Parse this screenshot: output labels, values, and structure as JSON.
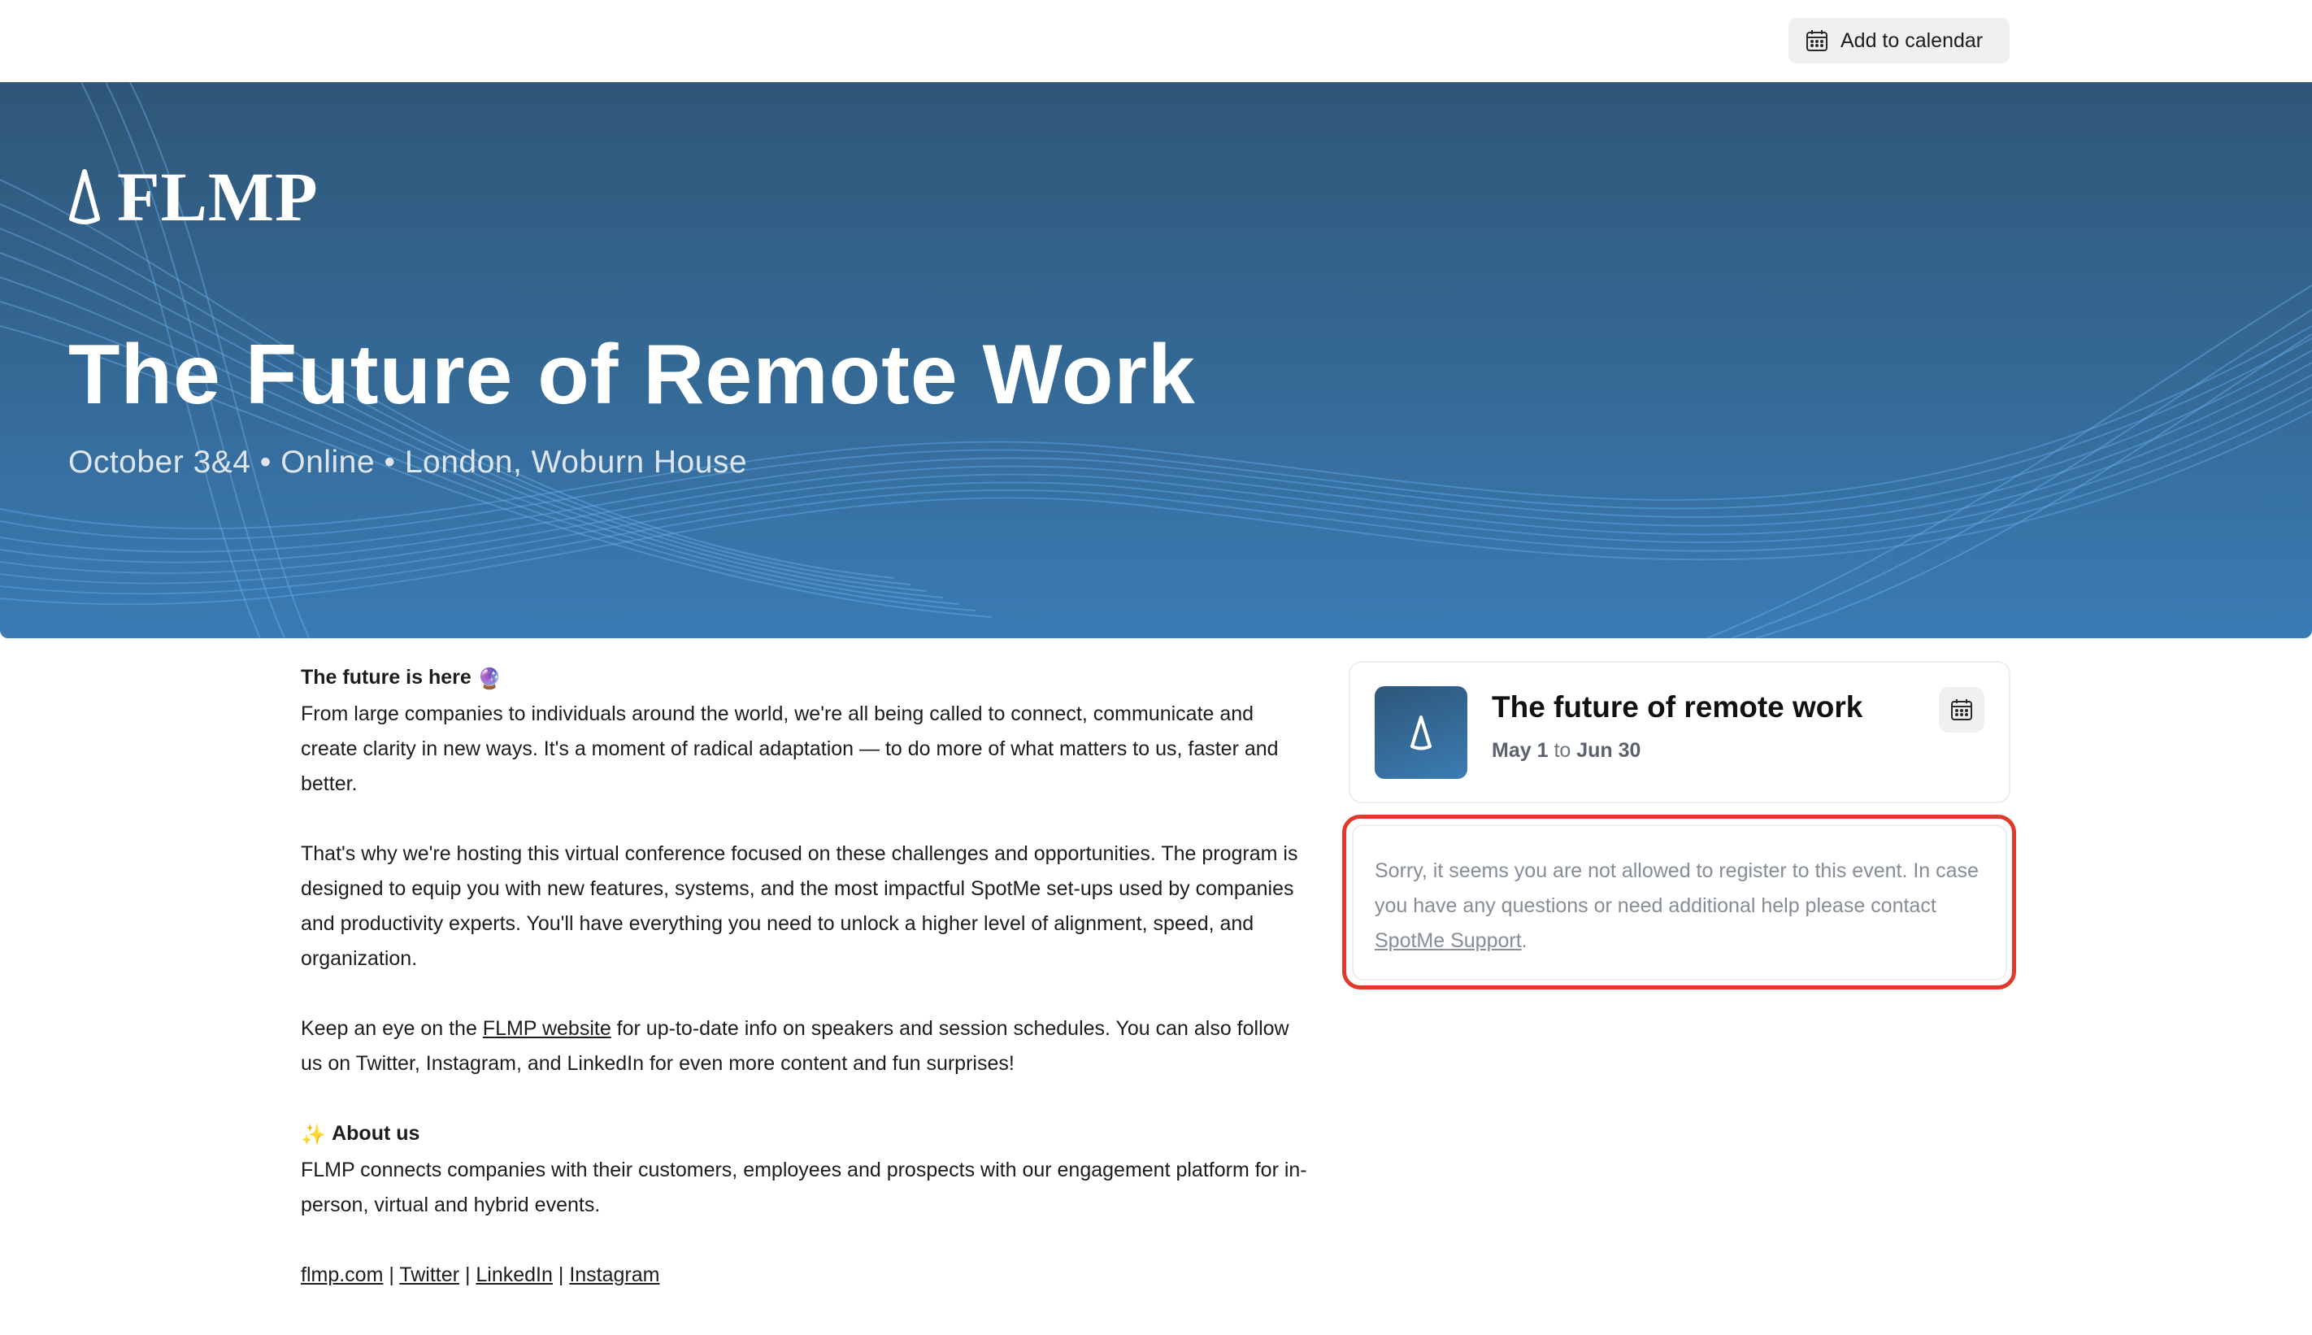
{
  "toolbar": {
    "add_to_calendar_label": "Add to calendar"
  },
  "hero": {
    "brand": "FLMP",
    "title": "The Future of Remote Work",
    "subtitle": "October 3&4 • Online • London, Woburn House"
  },
  "description": {
    "heading": "The future is here",
    "heading_emoji": "🔮",
    "paragraph1": "From large companies to individuals around the world, we're all being called to connect, communicate and create clarity in new ways. It's a moment of radical adaptation — to do more of what matters to us, faster and better.",
    "paragraph2": "That's why we're hosting this virtual conference focused on these challenges and opportunities. The program is designed to equip you with new features, systems, and the most impactful SpotMe set-ups used by companies and productivity experts. You'll have everything you need to unlock a higher level of alignment, speed, and organization.",
    "paragraph3_before": "Keep an eye on the ",
    "paragraph3_link": "FLMP website",
    "paragraph3_after": " for up-to-date info on speakers and session schedules. You can also follow us on Twitter, Instagram, and LinkedIn for even more content and fun surprises!",
    "about_emoji": "✨",
    "about_heading": "About us",
    "about_text": "FLMP connects companies with their customers, employees and prospects with our engagement platform for in-person, virtual and hybrid events.",
    "links": [
      "flmp.com",
      "Twitter",
      "LinkedIn",
      "Instagram"
    ],
    "link_separator": "|"
  },
  "event_card": {
    "title": "The future of remote work",
    "start_date": "May 1",
    "date_connector": "to",
    "end_date": "Jun 30"
  },
  "notice": {
    "text": "Sorry, it seems you are not allowed to register to this event. In case you have any questions or need additional help please contact ",
    "link": "SpotMe Support",
    "trailing": "."
  },
  "colors": {
    "hero_top": "#2f5677",
    "hero_bottom": "#3a7bb4",
    "highlight_outline": "#e03a2c",
    "notice_text": "#868d96"
  }
}
